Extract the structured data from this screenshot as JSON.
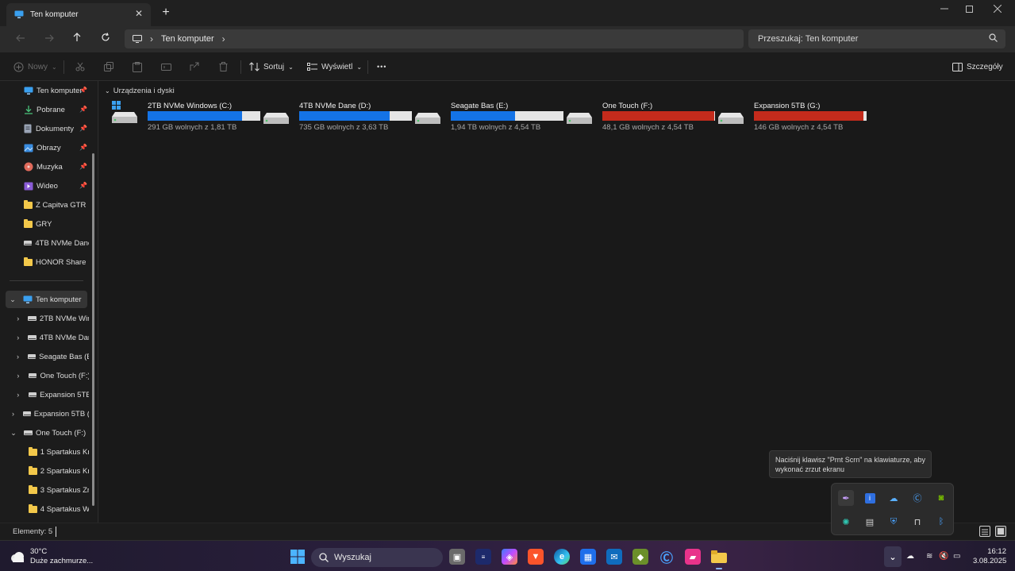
{
  "window": {
    "tab_title": "Ten komputer",
    "new_tab": "+",
    "close": "✕"
  },
  "address": {
    "segments": [
      "Ten komputer"
    ],
    "search_placeholder": "Przeszukaj: Ten komputer"
  },
  "commands": {
    "new_label": "Nowy",
    "sort_label": "Sortuj",
    "view_label": "Wyświetl",
    "more_label": "•••",
    "details_label": "Szczegóły"
  },
  "sidebar": {
    "quick_access": [
      {
        "label": "Ten komputer",
        "icon": "pc-icon",
        "pinned": true
      },
      {
        "label": "Pobrane",
        "icon": "download-icon",
        "pinned": true
      },
      {
        "label": "Dokumenty",
        "icon": "documents-icon",
        "pinned": true
      },
      {
        "label": "Obrazy",
        "icon": "pictures-icon",
        "pinned": true
      },
      {
        "label": "Muzyka",
        "icon": "music-icon",
        "pinned": true
      },
      {
        "label": "Wideo",
        "icon": "video-icon",
        "pinned": true
      },
      {
        "label": "Z Capitva GTR",
        "icon": "folder-icon",
        "pinned": false
      },
      {
        "label": "GRY",
        "icon": "folder-icon",
        "pinned": false
      },
      {
        "label": "4TB NVMe Dane",
        "icon": "drive-icon",
        "pinned": false
      },
      {
        "label": "HONOR Share",
        "icon": "folder-icon",
        "pinned": false
      }
    ],
    "tree": [
      {
        "label": "Ten komputer",
        "expanded": true,
        "selected": true,
        "indent": 0
      },
      {
        "label": "2TB NVMe Win",
        "expanded": false,
        "indent": 1
      },
      {
        "label": "4TB NVMe Dan",
        "expanded": false,
        "indent": 1
      },
      {
        "label": "Seagate Bas (E:",
        "expanded": false,
        "indent": 1
      },
      {
        "label": "One Touch (F:)",
        "expanded": false,
        "indent": 1
      },
      {
        "label": "Expansion 5TB",
        "expanded": false,
        "indent": 1
      },
      {
        "label": "Expansion 5TB (G",
        "expanded": false,
        "indent": 0
      },
      {
        "label": "One Touch (F:)",
        "expanded": true,
        "indent": 0
      },
      {
        "label": "1 Spartakus Kr",
        "folder": true,
        "indent": 1
      },
      {
        "label": "2 Spartakus Kr",
        "folder": true,
        "indent": 1
      },
      {
        "label": "3 Spartakus Zr",
        "folder": true,
        "indent": 1
      },
      {
        "label": "4 Spartakus W",
        "folder": true,
        "indent": 1
      }
    ]
  },
  "main": {
    "group_header": "Urządzenia i dyski",
    "drives": [
      {
        "name": "2TB NVMe Windows (C:)",
        "free_text": "291 GB wolnych z 1,81 TB",
        "used_fraction": 0.84,
        "bar_color": "#1473e6",
        "is_system": true
      },
      {
        "name": "4TB NVMe Dane (D:)",
        "free_text": "735 GB wolnych z 3,63 TB",
        "used_fraction": 0.8,
        "bar_color": "#1473e6",
        "is_system": false
      },
      {
        "name": "Seagate Bas (E:)",
        "free_text": "1,94 TB wolnych z 4,54 TB",
        "used_fraction": 0.57,
        "bar_color": "#1473e6",
        "is_system": false
      },
      {
        "name": "One Touch (F:)",
        "free_text": "48,1 GB wolnych z 4,54 TB",
        "used_fraction": 0.99,
        "bar_color": "#c42b1c",
        "is_system": false
      },
      {
        "name": "Expansion 5TB (G:)",
        "free_text": "146 GB wolnych z 4,54 TB",
        "used_fraction": 0.97,
        "bar_color": "#c42b1c",
        "is_system": false
      }
    ]
  },
  "status": {
    "text": "Elementy: 5"
  },
  "tooltip": {
    "text": "Naciśnij klawisz \"Prnt Scrn\" na klawiaturze, aby wykonać zrzut ekranu"
  },
  "taskbar": {
    "weather_temp": "30°C",
    "weather_desc": "Duże zachmurze...",
    "search_label": "Wyszukaj",
    "time": "16:12",
    "date": "3.08.2025"
  }
}
